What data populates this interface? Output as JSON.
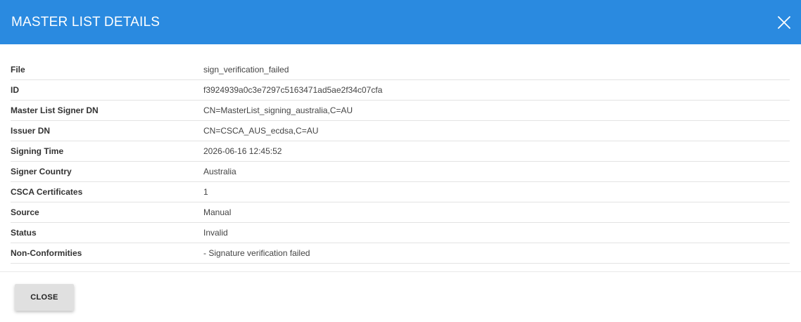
{
  "header": {
    "title": "MASTER LIST DETAILS",
    "close_icon": "close-icon",
    "background_color": "#2a8ae0"
  },
  "details": [
    {
      "label": "File",
      "value": "sign_verification_failed"
    },
    {
      "label": "ID",
      "value": "f3924939a0c3e7297c5163471ad5ae2f34c07cfa"
    },
    {
      "label": "Master List Signer DN",
      "value": "CN=MasterList_signing_australia,C=AU"
    },
    {
      "label": "Issuer DN",
      "value": "CN=CSCA_AUS_ecdsa,C=AU"
    },
    {
      "label": "Signing Time",
      "value": "2026-06-16 12:45:52"
    },
    {
      "label": "Signer Country",
      "value": "Australia"
    },
    {
      "label": "CSCA Certificates",
      "value": "1"
    },
    {
      "label": "Source",
      "value": "Manual"
    },
    {
      "label": "Status",
      "value": "Invalid"
    },
    {
      "label": "Non-Conformities",
      "value": "- Signature verification failed"
    }
  ],
  "footer": {
    "close_label": "CLOSE"
  }
}
